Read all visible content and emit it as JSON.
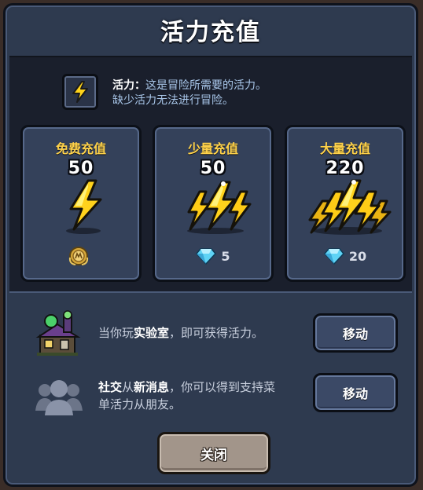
{
  "title": "活力充值",
  "info": {
    "key": "活力",
    "colon": "：",
    "line1_rest": "这是冒险所需要的活力。",
    "line2": "缺少活力无法进行冒险。"
  },
  "cards": [
    {
      "title": "免费充值",
      "amount": "50",
      "cost": "",
      "cost_icon": "ad-medal-icon"
    },
    {
      "title": "少量充值",
      "amount": "50",
      "cost": "5",
      "cost_icon": "gem-icon"
    },
    {
      "title": "大量充值",
      "amount": "220",
      "cost": "20",
      "cost_icon": "gem-icon"
    }
  ],
  "rows": [
    {
      "text_pre": "当你玩",
      "text_bold": "实验室",
      "text_post": "，即可获得活力。",
      "button": "移动",
      "icon": "laboratory-building-icon"
    },
    {
      "text_bold1": "社交",
      "text_mid": "从",
      "text_bold2": "新消息",
      "text_post1": "，你可以得到支持菜",
      "text_line2": "单活力从朋友。",
      "button": "移动",
      "icon": "social-friends-icon"
    }
  ],
  "close_label": "关闭",
  "colors": {
    "accent_gold": "#ffd24a",
    "panel": "#2e3a4f",
    "gem": "#5fd3f5"
  }
}
